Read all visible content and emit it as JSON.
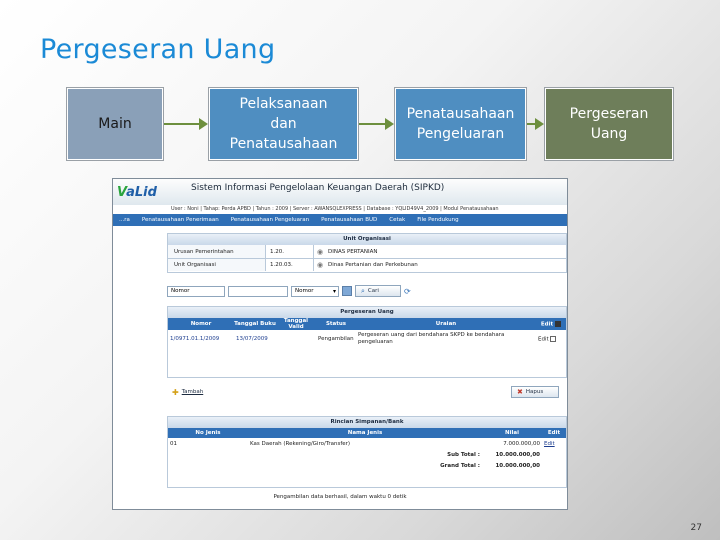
{
  "slide": {
    "title": "Pergeseran Uang",
    "page_number": "27"
  },
  "flow": [
    {
      "label": "Main"
    },
    {
      "label": "Pelaksanaan dan Penatausahaan"
    },
    {
      "label": "Penatausahaan Pengeluaran"
    },
    {
      "label": "Pergeseran Uang"
    }
  ],
  "app": {
    "logo_prefix": "V",
    "logo_rest": "aLid",
    "system_title": "Sistem Informasi Pengelolaan Keuangan Daerah (SIPKD)",
    "infobar": "User : Noni | Tahap: Perda APBD | Tahun : 2009 | Server : AWANSQLEXPRESS | Database : YQLID49V4_2009 | Modul Penatausahaan",
    "menu": [
      "...ra",
      "Penatausahaan Penerimaan",
      "Penatausahaan Pengeluaran",
      "Penatausahaan BUD",
      "Cetak",
      "File Pendukung"
    ],
    "unit_panel": {
      "title": "Unit Organisasi",
      "rows": [
        {
          "label": "Urusan Pemerintahan",
          "code": "1.20.",
          "name": "DINAS PERTANIAN"
        },
        {
          "label": "Unit Organisasi",
          "code": "1.20.03.",
          "name": "Dinas Pertanian dan Perkebunan"
        }
      ]
    },
    "search": {
      "field_label": "Nomor",
      "select_value": "Nomor",
      "button_label": "Cari"
    },
    "pergeseran_panel": {
      "title": "Pergeseran Uang",
      "columns": [
        "Nomor",
        "Tanggal Buku",
        "Tanggal Valid",
        "Status",
        "Uraian",
        "Edit"
      ],
      "rows": [
        {
          "nomor": "1/0971.01.1/2009",
          "tgl_buku": "13/07/2009",
          "tgl_valid": "",
          "status": "Pengambilan",
          "uraian": "Pergeseran uang dari bendahara SKPD ke bendahara pengeluaran",
          "edit": "Edit"
        }
      ]
    },
    "add_button": "Tambah",
    "delete_button": "Hapus",
    "rincian_panel": {
      "title": "Rincian Simpanan/Bank",
      "columns": [
        "No Jenis",
        "Nama Jenis",
        "Nilai",
        "Edit"
      ],
      "rows": [
        {
          "no": "01",
          "nama": "Kas Daerah (Rekening/Giro/Transfer)",
          "nilai": "7.000.000,00",
          "edit": "Edit"
        }
      ],
      "subtotal_label": "Sub Total :",
      "subtotal_value": "10.000.000,00",
      "grandtotal_label": "Grand Total :",
      "grandtotal_value": "10.000.000,00"
    },
    "footer_note": "Pengambilan data berhasil, dalam waktu 0 detik"
  },
  "colors": {
    "title": "#1b8ad6",
    "flow_blue": "#4f8ec1",
    "flow_green": "#6e7e5a",
    "arrow": "#6d8f3e",
    "menu_bar": "#2f6fb6"
  }
}
